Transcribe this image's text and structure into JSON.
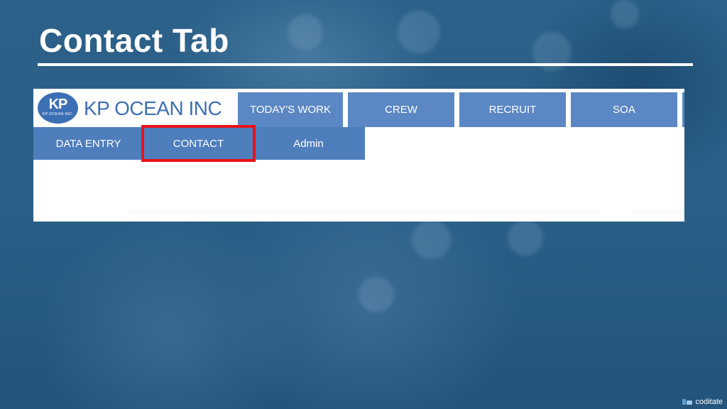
{
  "slide": {
    "title": "Contact Tab"
  },
  "app": {
    "logo": {
      "badge_mark": "KP",
      "badge_text": "KP OCEAN INC.",
      "wordmark": "KP OCEAN INC"
    },
    "top_tabs": [
      {
        "label": "TODAY'S WORK"
      },
      {
        "label": "CREW"
      },
      {
        "label": "RECRUIT"
      },
      {
        "label": "SOA"
      }
    ],
    "sub_tabs": [
      {
        "label": "DATA ENTRY"
      },
      {
        "label": "CONTACT",
        "highlighted": true
      },
      {
        "label": "Admin"
      }
    ],
    "colors": {
      "tab_blue": "#5b88c4",
      "subtab_blue": "#4f7ebd",
      "logo_blue": "#3d6fb4",
      "highlight_red": "#e8121a"
    }
  },
  "watermark": {
    "text": "coditate",
    "icon": "coditate-logo-icon"
  }
}
